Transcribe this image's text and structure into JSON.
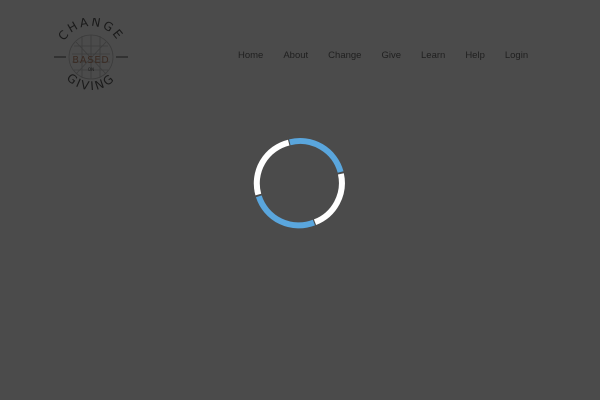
{
  "logo": {
    "top_text": "CHANGE",
    "middle_text": "BASED",
    "small_text": "ON",
    "bottom_text": "GIVING",
    "color": "#1a1a1a",
    "accent": "#3a2a22"
  },
  "nav": {
    "items": [
      {
        "label": "Home"
      },
      {
        "label": "About"
      },
      {
        "label": "Change"
      },
      {
        "label": "Give"
      },
      {
        "label": "Learn"
      },
      {
        "label": "Help"
      },
      {
        "label": "Login"
      }
    ]
  },
  "loader": {
    "primary_color": "#5aa6dd",
    "secondary_color": "#ffffff",
    "icon": "loading-spinner-icon"
  },
  "colors": {
    "background": "#4b4b4b",
    "nav_text": "#1f1f1f"
  }
}
